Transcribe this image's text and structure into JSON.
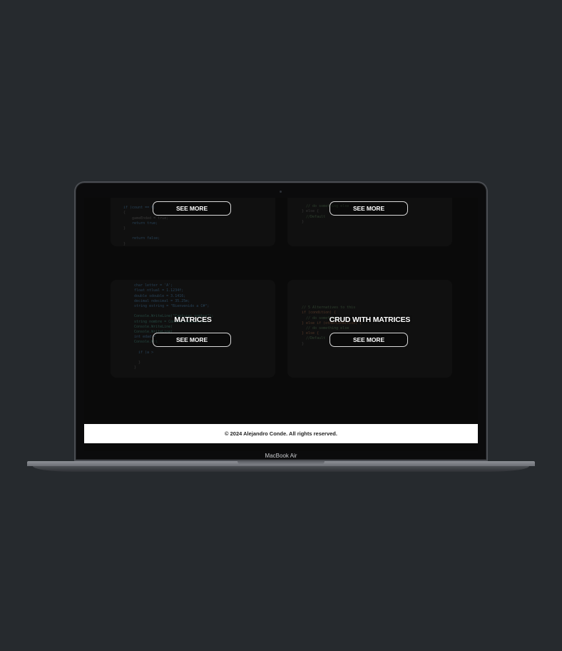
{
  "device": {
    "model_label": "MacBook Air"
  },
  "cards": [
    {
      "id": "top-left",
      "title": "",
      "button": "SEE MORE",
      "code": [
        "if (count == 0)",
        "{",
        "    gameEnded = true;",
        "    return true;",
        "}",
        "",
        "    return false;",
        "}"
      ]
    },
    {
      "id": "top-right",
      "title": "",
      "button": "SEE MORE",
      "code": [
        "  // do something else",
        "} else {",
        "  //Default",
        "}"
      ]
    },
    {
      "id": "bottom-left",
      "title": "MATRICES",
      "button": "SEE MORE",
      "code": [
        "char letter = 'A';",
        "float ntlual = 1.1234f;",
        "double sdouble = 3.1416;",
        "decimal ndecimal = 35.25m;",
        "string estring = \"Bienvenido a C#\";",
        "",
        "Console.WriteLine(\"Capturar nombre\");",
        "string nombre = Console.ReadLine();",
        "Console.WriteLine(",
        "Console.WriteLine(",
        "int edad = ",
        "Console.Wri",
        "",
        "  if (a >",
        "",
        "  }",
        "}"
      ]
    },
    {
      "id": "bottom-right",
      "title": "CRUD WITH MATRICES",
      "button": "SEE MORE",
      "code": [
        "// 5 Alternatives to this",
        "if (condition) {",
        "  // do something",
        "} else if (otherCondition) {",
        "  // do something else",
        "} else {",
        "  //Default",
        "}"
      ]
    }
  ],
  "footer": {
    "copyright": "© 2024 Alejandro Conde. All rights reserved."
  }
}
